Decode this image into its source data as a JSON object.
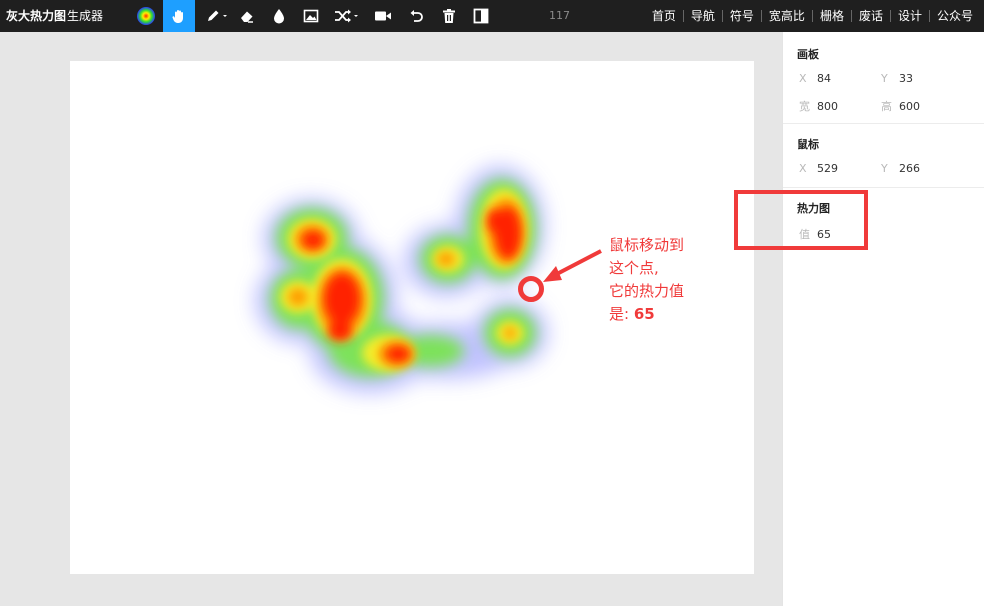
{
  "app": {
    "brand_bold": "灰大热力图",
    "brand_light": "生成器",
    "counter": "117"
  },
  "toolbar": {
    "tools": [
      {
        "name": "heat-gradient-icon"
      },
      {
        "name": "hand-icon",
        "active": true
      },
      {
        "name": "pen-icon",
        "has_dropdown": true
      },
      {
        "name": "eraser-icon"
      },
      {
        "name": "drop-icon"
      },
      {
        "name": "image-icon"
      },
      {
        "name": "shuffle-icon",
        "has_dropdown": true
      },
      {
        "name": "video-icon"
      },
      {
        "name": "undo-icon"
      },
      {
        "name": "trash-icon"
      },
      {
        "name": "panel-toggle-icon"
      }
    ]
  },
  "nav": {
    "items": [
      "首页",
      "导航",
      "符号",
      "宽高比",
      "栅格",
      "废话",
      "设计",
      "公众号"
    ]
  },
  "panel": {
    "board": {
      "title": "画板",
      "x_label": "X",
      "x": "84",
      "y_label": "Y",
      "y": "33",
      "w_label": "宽",
      "w": "800",
      "h_label": "高",
      "h": "600"
    },
    "mouse": {
      "title": "鼠标",
      "x_label": "X",
      "x": "529",
      "y_label": "Y",
      "y": "266"
    },
    "heatmap": {
      "title": "热力图",
      "value_label": "值",
      "value": "65"
    }
  },
  "annotation": {
    "line1": "鼠标移动到",
    "line2": "这个点,",
    "line3": "它的热力值",
    "line4_prefix": "是:",
    "line4_value": "65",
    "color": "#f03a3a"
  },
  "colors": {
    "topbar": "#1f1f1f",
    "active_tool": "#1e9fff",
    "highlight": "#f03a3a"
  }
}
